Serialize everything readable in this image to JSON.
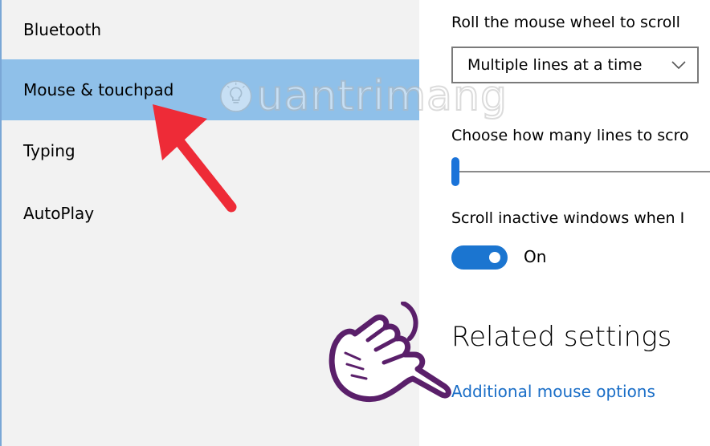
{
  "sidebar": {
    "items": [
      {
        "label": "Bluetooth"
      },
      {
        "label": "Mouse & touchpad",
        "active": true
      },
      {
        "label": "Typing"
      },
      {
        "label": "AutoPlay"
      }
    ]
  },
  "settings": {
    "scroll_wheel_label": "Roll the mouse wheel to scroll",
    "scroll_wheel_value": "Multiple lines at a time",
    "lines_label": "Choose how many lines to scro",
    "lines_level": 0.0,
    "inactive_label": "Scroll inactive windows when I",
    "inactive_state": "On",
    "related_heading": "Related settings",
    "additional_link": "Additional mouse options"
  },
  "watermark": {
    "text": "uantrimang"
  },
  "colors": {
    "accent": "#1b75d0",
    "selected": "#8fc0e9",
    "link": "#1a6ec7",
    "arrow": "#ee2b37",
    "hand": "#5a1f6a"
  },
  "icons": {
    "dropdown": "chevron-down-icon",
    "annotation_arrow": "red-arrow-icon",
    "pointing_hand": "pointing-hand-icon",
    "watermark_logo": "lightbulb-icon"
  }
}
